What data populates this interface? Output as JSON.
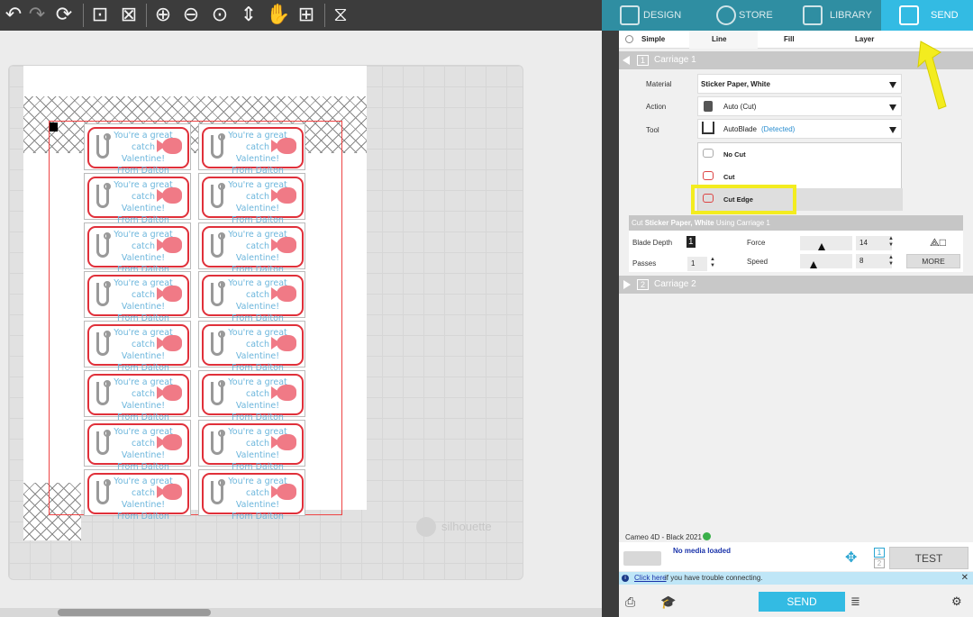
{
  "toolbar": {
    "icons": [
      "undo-icon",
      "redo-icon",
      "refresh-icon",
      "select-all-icon",
      "deselect-icon",
      "zoom-in-icon",
      "zoom-out-icon",
      "zoom-fit-icon",
      "move-page-icon",
      "pan-hand-icon",
      "fit-to-window-icon",
      "tools-icon"
    ]
  },
  "nav": {
    "design": "DESIGN",
    "store": "STORE",
    "library": "LIBRARY",
    "send": "SEND"
  },
  "modes": {
    "simple": "Simple",
    "line": "Line",
    "fill": "Fill",
    "layer": "Layer"
  },
  "carriage1": {
    "num": "1",
    "label": "Carriage 1"
  },
  "carriage2": {
    "num": "2",
    "label": "Carriage 2"
  },
  "settings": {
    "material_label": "Material",
    "material_value": "Sticker Paper, White",
    "action_label": "Action",
    "action_value": "Auto (Cut)",
    "tool_label": "Tool",
    "tool_value": "AutoBlade",
    "tool_detected": "(Detected)"
  },
  "dropdown": {
    "items": [
      "No Cut",
      "Cut",
      "Cut Edge"
    ],
    "selected": "Cut Edge"
  },
  "cut_panel": {
    "header_prefix": "Cut",
    "header_material": "Sticker Paper, White",
    "header_suffix": "Using Carriage 1",
    "blade_depth_label": "Blade Depth",
    "blade_depth_value": "1",
    "force_label": "Force",
    "force_value": "14",
    "passes_label": "Passes",
    "passes_value": "1",
    "speed_label": "Speed",
    "speed_value": "8",
    "more_label": "MORE"
  },
  "sticker": {
    "line1": "You're a great catch",
    "line2": "Valentine!",
    "line3": "From Dalton"
  },
  "canvas": {
    "watermark": "silhouette"
  },
  "machine": {
    "name": "Cameo 4D - Black 2021",
    "media": "No media loaded",
    "carriage_1": "1",
    "carriage_2": "2",
    "test_label": "TEST"
  },
  "info": {
    "link": "Click here",
    "text": "if you have trouble connecting."
  },
  "bottom": {
    "send_label": "SEND"
  },
  "colors": {
    "accent": "#33bbe3",
    "nav_bg": "#2f8ea2",
    "highlight": "#f3ec1f",
    "cut_red": "#e0303a"
  }
}
